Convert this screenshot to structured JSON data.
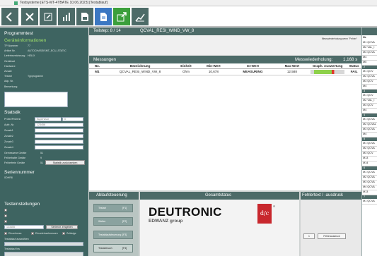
{
  "window": {
    "title": "Testsysteme [ETS-MT-4TBATE 10.06.2023] [Testablauf]"
  },
  "toolbar": {
    "buttons": [
      "back-icon",
      "tools-icon",
      "edit-icon",
      "chart-icon",
      "save-icon",
      "document-icon",
      "export-icon",
      "trend-icon"
    ]
  },
  "left": {
    "title": "Programmtest",
    "device_section": "Geräteinformationen",
    "device_fields": [
      {
        "label": "TP-Nummer",
        "value": "77"
      },
      {
        "label": "Artikel Nr.",
        "value": "AUTOCHASSISMT_ECU_STATIC"
      },
      {
        "label": "Lieferbezeichnung",
        "value": "HELIX"
      },
      {
        "label": "Geräteart",
        "value": ""
      },
      {
        "label": "Hardware",
        "value": ""
      },
      {
        "label": "Zusatz",
        "value": ""
      },
      {
        "label": "Testart",
        "value": "Typprogramm"
      },
      {
        "label": "Adp. Nr.",
        "value": ""
      },
      {
        "label": "Bemerkung",
        "value": ""
      }
    ],
    "stat_section": "Statistik",
    "stat_prueferin": "Prüfer/Prüferin",
    "stat_user": "Supervisor",
    "stat_user_num": "0",
    "stat_auftrag": "Auftr.-Nr.",
    "stat_auftrag_value": "123456",
    "stat_zusatz": [
      "Zusatz1",
      "Zusatz2",
      "Zusatz3",
      "Zusatz4"
    ],
    "stat_counts": [
      {
        "label": "Gemessene Geräte",
        "value": "51"
      },
      {
        "label": "Fehlerhafte Geräte",
        "value": "9"
      },
      {
        "label": "Fehlerfreie Geräte",
        "value": "51"
      }
    ],
    "stat_button": "Statistik zurücksetzen",
    "serial_section": "Seriennummer",
    "serial_value": "0DHR8",
    "test_section": "Testeinstellungen",
    "test_input": "123455",
    "test_btn": "Seriennr. eingeben",
    "checkboxes": [
      "Einzelmess",
      "Einzeleinzelmessen",
      "Zuläsige"
    ],
    "field_a": "Testablauf auswählen",
    "field_b": "Testablauf bis"
  },
  "main": {
    "step_label": "Teilstep: 8 / 14",
    "step_name": "QCVAL_RESI_WIND_VW_8",
    "note": "Messwiederholung wenn \"Fehler\"",
    "messungen_title": "Messungen",
    "repeat_label": "Messwiederholung:",
    "repeat_value": "1,168 s",
    "columns": [
      "No.",
      "Bezeichnung",
      "Einheit",
      "Min-Wert",
      "Ist-Wert",
      "Max-Wert",
      "Graph. Auswertung",
      "Status"
    ],
    "rows": [
      {
        "no": "M1",
        "name": "QCVAL_RESI_WIND_VW_8",
        "unit": "Ohm",
        "min": "10,678",
        "ist": "MEASURING",
        "max": "12,588",
        "graph_fill": 0.62,
        "status": "FAIL"
      }
    ]
  },
  "bottom": {
    "ablauf_title": "Ablaufsteuerung",
    "gesamt_title": "Gesamtstatus",
    "fehler_title": "Fehlertext / -ausdruck",
    "ablauf_buttons": [
      {
        "label": "Testart",
        "key": "[F1]"
      },
      {
        "label": "Weiter",
        "key": "[F2]"
      },
      {
        "label": "Testablaufsteuerung",
        "key": "[F3]"
      },
      {
        "label": "Testabbruch",
        "key": "[F4]"
      }
    ],
    "logo_text": "DEUTRONIC",
    "logo_sub": "EDWANZ group",
    "logo_mark": "d/c",
    "logo_reg": "®",
    "fehler_page": "1",
    "fehler_btn": "Fehlerausdruck"
  },
  "right_panel": {
    "header": "Nr.",
    "groups": [
      {
        "title": "",
        "rows": [
          "M1 QCVA",
          "M2 VAL_I",
          "M3 QCVA",
          "M4",
          "M5"
        ]
      },
      {
        "title": "2",
        "rows": [
          "M1 QCV",
          "M2 QCVA",
          "M3 QCV",
          "M4"
        ]
      },
      {
        "title": "3",
        "rows": [
          "M1 QCV",
          "M2 VAL_I",
          "M3 QCV",
          "M4"
        ]
      },
      {
        "title": "4",
        "rows": [
          "M1 QCVA",
          "M2 QCVAL",
          "M3 QCVA",
          "M4"
        ]
      },
      {
        "title": "5",
        "rows": [
          "M1 QCVA",
          "M2 QCVA",
          "M3 QCV",
          "M13",
          "M14"
        ]
      },
      {
        "title": "6",
        "rows": [
          "M1 QCVA",
          "M2 QCVA",
          "M3 QCVA",
          "M4 QCVA",
          "M13"
        ]
      },
      {
        "title": "7",
        "rows": [
          "M1 QCVA"
        ]
      }
    ]
  },
  "colors": {
    "panel": "#4d6b68",
    "sidebar": "#3e6461",
    "accent_green": "#9fe06a",
    "fail": "#d6201a",
    "logo_red": "#c8272d"
  }
}
